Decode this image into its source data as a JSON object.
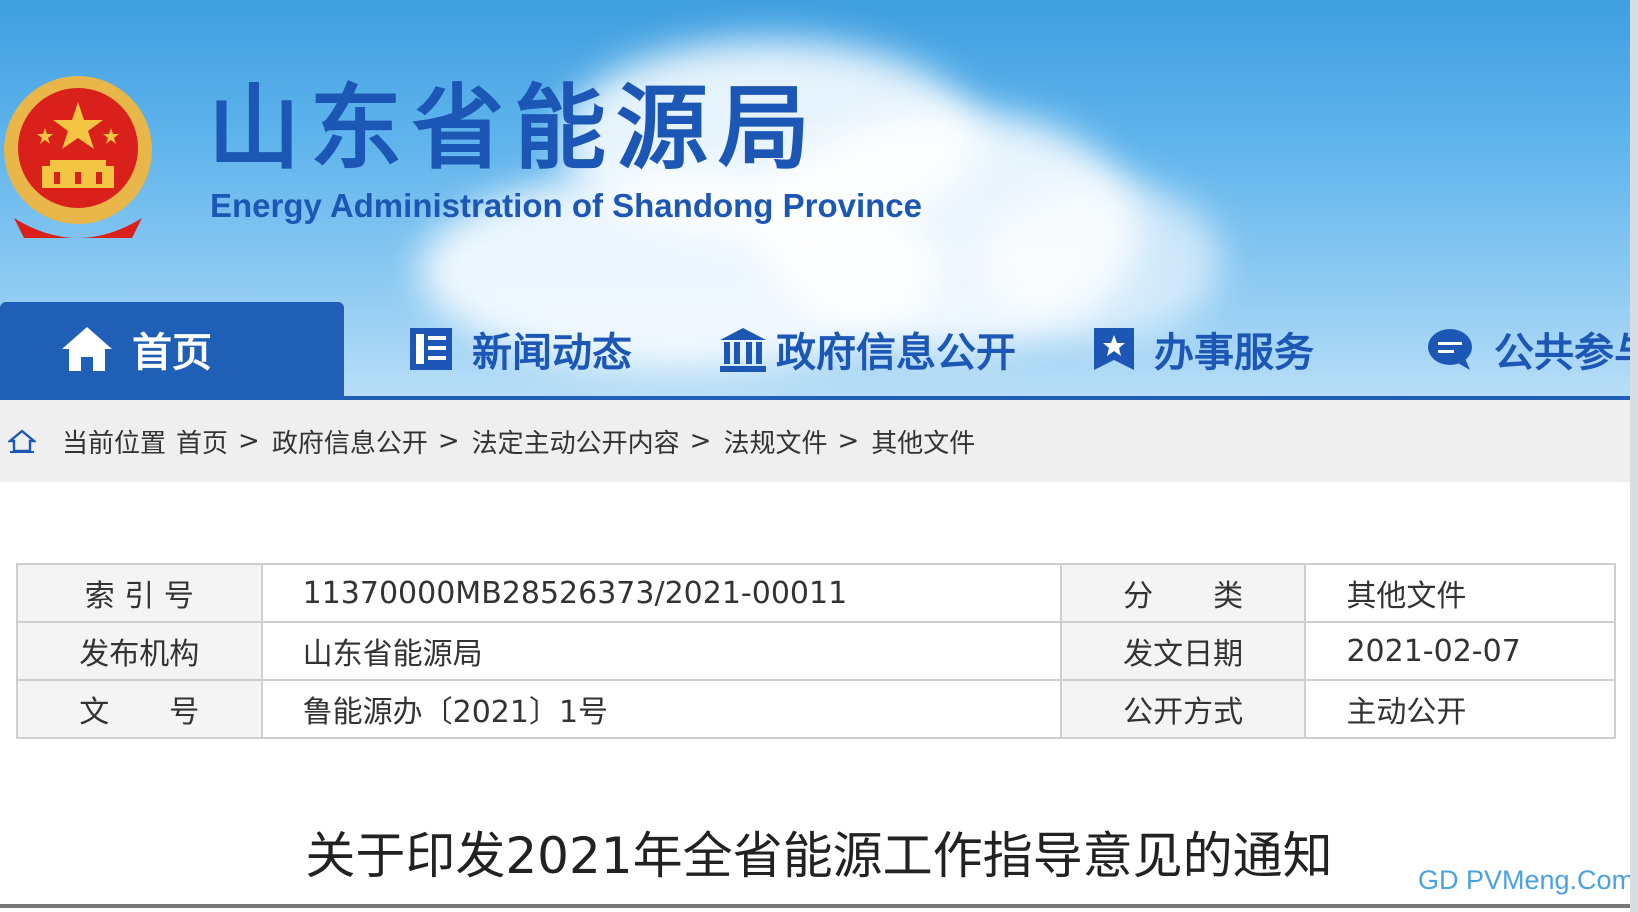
{
  "header": {
    "title": "山东省能源局",
    "subtitle": "Energy Administration of Shandong Province",
    "emblem": "national-emblem-logo"
  },
  "nav": {
    "items": [
      {
        "label": "首页",
        "icon": "home-icon",
        "active": true
      },
      {
        "label": "新闻动态",
        "icon": "newspaper-icon"
      },
      {
        "label": "政府信息公开",
        "icon": "government-building-icon"
      },
      {
        "label": "办事服务",
        "icon": "bookmark-star-icon"
      },
      {
        "label": "公共参与",
        "icon": "chat-bubble-icon"
      }
    ]
  },
  "breadcrumb": {
    "icon": "home-icon",
    "prefix": "当前位置",
    "items": [
      "首页",
      "政府信息公开",
      "法定主动公开内容",
      "法规文件",
      "其他文件"
    ],
    "separator": ">"
  },
  "meta": {
    "rows": [
      {
        "label1": "索 引 号",
        "value1": "11370000MB28526373/2021-00011",
        "label2": "分　　类",
        "value2": "其他文件"
      },
      {
        "label1": "发布机构",
        "value1": "山东省能源局",
        "label2": "发文日期",
        "value2": "2021-02-07"
      },
      {
        "label1": "文　　号",
        "value1": "鲁能源办〔2021〕1号",
        "label2": "公开方式",
        "value2": "主动公开"
      }
    ]
  },
  "document": {
    "title": "关于印发2021年全省能源工作指导意见的通知"
  },
  "watermark": "GD PVMeng.Com",
  "colors": {
    "brand_blue": "#1d57b5",
    "nav_active": "#1f5fb5",
    "breadcrumb_bg": "#efefef",
    "watermark": "#4aa3e0"
  }
}
